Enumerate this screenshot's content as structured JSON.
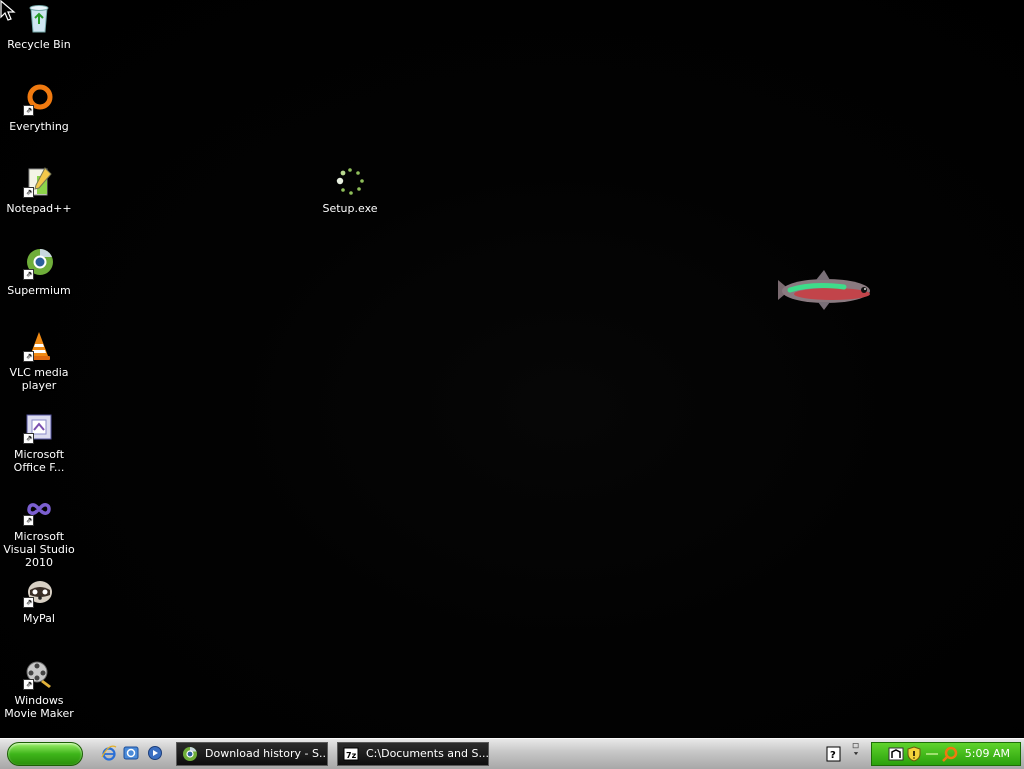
{
  "desktop": {
    "icons": [
      {
        "label": "Recycle Bin",
        "icon": "recycle-bin-icon"
      },
      {
        "label": "Everything",
        "icon": "everything-icon"
      },
      {
        "label": "Notepad++",
        "icon": "notepad-plus-plus-icon"
      },
      {
        "label": "Supermium",
        "icon": "supermium-icon"
      },
      {
        "label": "VLC media player",
        "icon": "vlc-icon"
      },
      {
        "label": "Microsoft Office F...",
        "icon": "office-icon"
      },
      {
        "label": "Microsoft Visual Studio 2010",
        "icon": "visual-studio-icon"
      },
      {
        "label": "MyPal",
        "icon": "mypal-icon"
      },
      {
        "label": "Windows Movie Maker",
        "icon": "movie-maker-icon"
      },
      {
        "label": "Setup.exe",
        "icon": "setup-exe-icon"
      }
    ]
  },
  "taskbar": {
    "tasks": [
      {
        "label": "Download history - S...",
        "icon": "supermium-icon"
      },
      {
        "label": "C:\\Documents and S...",
        "icon": "7zip-icon"
      }
    ],
    "clock": "5:09 AM"
  },
  "colors": {
    "start_green": "#3eb51a",
    "tray_green": "#2aa10c"
  }
}
